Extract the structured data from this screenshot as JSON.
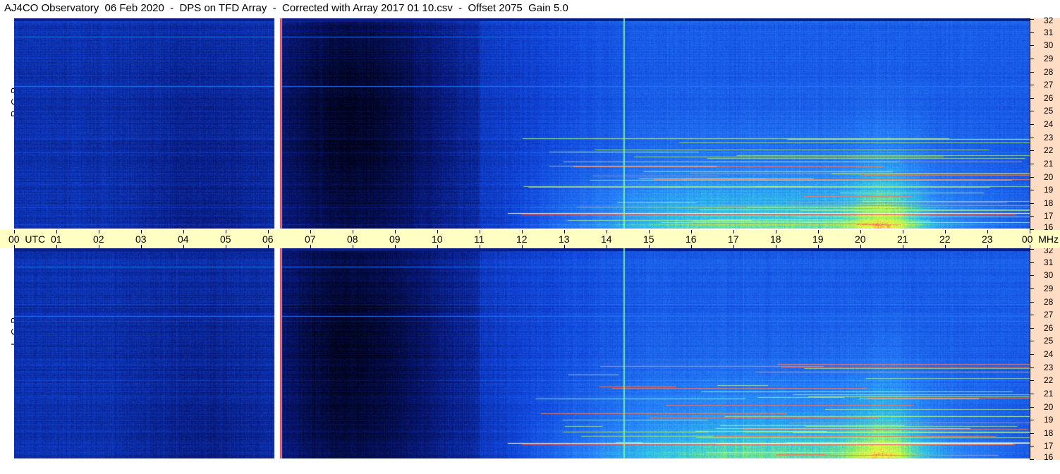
{
  "title": "AJ4CO Observatory  06 Feb 2020  -  DPS on TFD Array  -  Corrected with Array 2017 01 10.csv  -  Offset 2075  Gain 5.0",
  "panels": {
    "top_label": "R  C  P",
    "bottom_label": "L  C  P"
  },
  "chart_data": [
    {
      "type": "heatmap",
      "title": "RCP",
      "x_axis": {
        "unit": "UTC",
        "range": [
          0,
          24
        ],
        "tick_labels": [
          "00",
          "01",
          "02",
          "03",
          "04",
          "05",
          "06",
          "07",
          "08",
          "09",
          "10",
          "11",
          "12",
          "13",
          "14",
          "15",
          "16",
          "17",
          "18",
          "19",
          "20",
          "21",
          "22",
          "23",
          "00"
        ],
        "first_label": "00  UTC"
      },
      "y_axis": {
        "unit": "MHz",
        "range": [
          16,
          32
        ],
        "tick_labels": [
          "32",
          "31",
          "30",
          "29",
          "28",
          "27",
          "26",
          "25",
          "24",
          "23",
          "22",
          "21",
          "20",
          "19",
          "18",
          "17",
          "16"
        ]
      },
      "colormap": [
        "#000010",
        "#0a2a9e",
        "#1a5cf0",
        "#30c0e8",
        "#a0f060",
        "#f0ff40",
        "#ff6040",
        "#ffffff"
      ],
      "notable_features": [
        {
          "time_utc": 6.3,
          "note": "vertical bright line"
        },
        {
          "time_utc": 14.4,
          "note": "vertical bright line"
        }
      ]
    },
    {
      "type": "heatmap",
      "title": "LCP",
      "x_axis": {
        "unit": "UTC",
        "range": [
          0,
          24
        ]
      },
      "y_axis": {
        "unit": "MHz",
        "range": [
          16,
          32
        ],
        "tick_labels": [
          "32",
          "31",
          "30",
          "29",
          "28",
          "27",
          "26",
          "25",
          "24",
          "23",
          "22",
          "21",
          "20",
          "19",
          "18",
          "17",
          "16"
        ]
      }
    }
  ],
  "x_axis_labels": [
    "00  UTC",
    "01",
    "02",
    "03",
    "04",
    "05",
    "06",
    "07",
    "08",
    "09",
    "10",
    "11",
    "12",
    "13",
    "14",
    "15",
    "16",
    "17",
    "18",
    "19",
    "20",
    "21",
    "22",
    "23",
    "00  MHz"
  ],
  "y_axis_labels": [
    "32",
    "31",
    "30",
    "29",
    "28",
    "27",
    "26",
    "25",
    "24",
    "23",
    "22",
    "21",
    "20",
    "19",
    "18",
    "17",
    "16"
  ],
  "colors": {
    "x_axis_bg": "#ffffc4",
    "y_axis_bg": "#ffdcc4"
  }
}
